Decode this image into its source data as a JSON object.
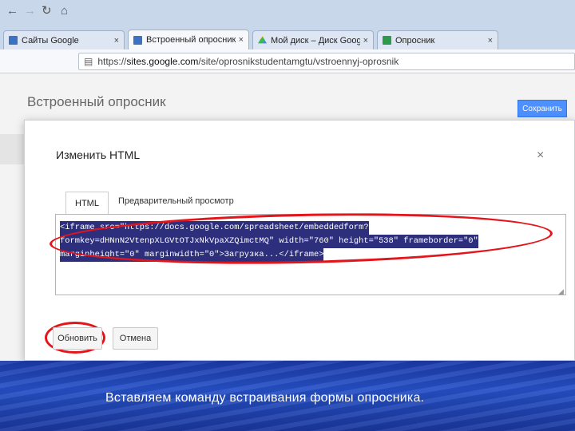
{
  "browser": {
    "tabs": [
      {
        "title": "Сайты Google",
        "active": false
      },
      {
        "title": "Встроенный опросник - От",
        "active": true
      },
      {
        "title": "Мой диск – Диск Google",
        "active": false
      },
      {
        "title": "Опросник",
        "active": false
      }
    ],
    "close_glyph": "×",
    "url_scheme": "https://",
    "url_host": "sites.google.com",
    "url_path": "/site/oprosnikstudentamgtu/vstroennyj-oprosnik"
  },
  "page": {
    "title": "Встроенный опросник",
    "save_label": "Сохранить"
  },
  "dialog": {
    "title": "Изменить HTML",
    "close_glyph": "×",
    "tab_html": "HTML",
    "tab_preview": "Предварительный просмотр",
    "code_lines": [
      "<iframe src=\"https://docs.google.com/spreadsheet/embeddedform?",
      "formkey=dHNnN2VtenpXLGVtOTJxNkVpaXZQimctMQ\" width=\"760\" height=\"538\" frameborder=\"0\"",
      "marginheight=\"0\" marginwidth=\"0\">Загрузка...</iframe>"
    ],
    "update_label": "Обновить",
    "cancel_label": "Отмена"
  },
  "annotation": {
    "color": "#e4141b"
  },
  "caption": "Вставляем команду встраивания формы опросника."
}
